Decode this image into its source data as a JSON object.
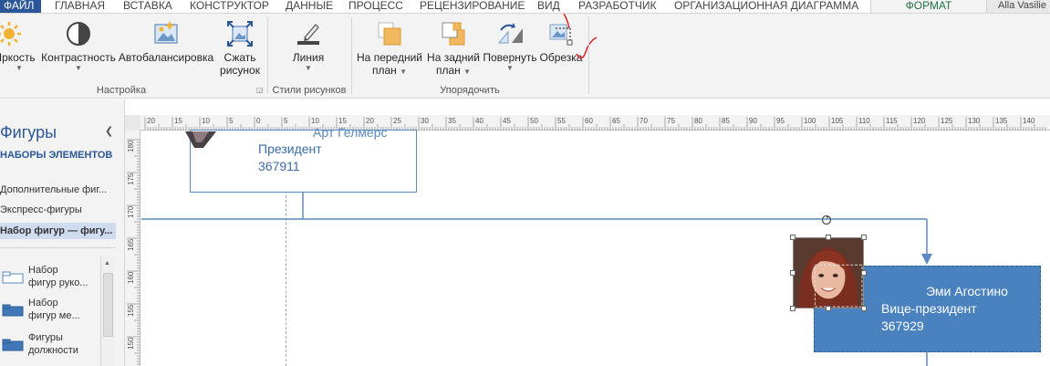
{
  "tabs": {
    "file": "ФАЙЛ",
    "items": [
      "ГЛАВНАЯ",
      "ВСТАВКА",
      "КОНСТРУКТОР",
      "ДАННЫЕ",
      "ПРОЦЕСС",
      "РЕЦЕНЗИРОВАНИЕ",
      "ВИД",
      "РАЗРАБОТЧИК",
      "ОРГАНИЗАЦИОННАЯ ДИАГРАММА"
    ],
    "active": "ФОРМАТ",
    "user": "Alla Vasilie"
  },
  "ribbon": {
    "adjust": {
      "brightness": "Яркость",
      "contrast": "Контрастность",
      "autobalance": "Автобалансировка",
      "compress_line1": "Сжать",
      "compress_line2": "рисунок",
      "group_label": "Настройка"
    },
    "styles": {
      "line": "Линия",
      "group_label": "Стили рисунков"
    },
    "arrange": {
      "front_line1": "На передний",
      "front_line2": "план",
      "back_line1": "На задний",
      "back_line2": "план",
      "rotate": "Повернуть",
      "crop": "Обрезка",
      "group_label": "Упорядочить"
    },
    "accent_color": "#2b579a",
    "format_color": "#217346"
  },
  "shapes_panel": {
    "title": "Фигуры",
    "subtitle": "НАБОРЫ ЭЛЕМЕНТОВ",
    "links": [
      "Дополнительные фиг...",
      "Экспресс-фигуры",
      "Набор фигур — фигу..."
    ],
    "stencils": [
      {
        "line1": "Набор",
        "line2": "фигур руко..."
      },
      {
        "line1": "Набор",
        "line2": "фигур ме..."
      },
      {
        "line1": "Фигуры",
        "line2": "должности"
      }
    ]
  },
  "ruler": {
    "h_labels": [
      "20",
      "15",
      "10",
      "5",
      "0",
      "5",
      "10",
      "15",
      "20",
      "25",
      "30",
      "35",
      "40",
      "45",
      "50",
      "55",
      "60",
      "65",
      "70",
      "75",
      "80",
      "85",
      "90",
      "95",
      "100",
      "105",
      "110",
      "115",
      "120",
      "125",
      "130",
      "135",
      "140"
    ],
    "v_labels": [
      "180",
      "175",
      "170",
      "165",
      "160",
      "155",
      "150"
    ]
  },
  "diagram": {
    "person1": {
      "name": "Арт Гелмерс",
      "role": "Президент",
      "id": "367911"
    },
    "person2": {
      "name": "Эми Агостино",
      "role": "Вице-президент",
      "id": "367929"
    },
    "box_fill": "#4a82bf",
    "line_color": "#5b8ac2"
  }
}
